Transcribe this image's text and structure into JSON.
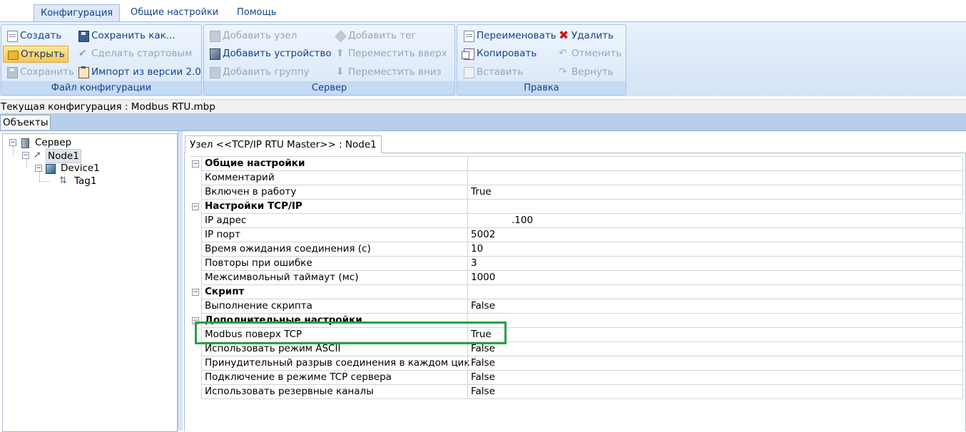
{
  "ribbon_tabs": [
    "Конфигурация",
    "Общие настройки",
    "Помощь"
  ],
  "groups": {
    "file": {
      "label": "Файл конфигурации",
      "create": "Создать",
      "open": "Открыть",
      "save": "Сохранить",
      "save_as": "Сохранить как...",
      "make_start": "Сделать стартовым",
      "import": "Импорт из версии 2.0"
    },
    "server": {
      "label": "Сервер",
      "add_node": "Добавить узел",
      "add_device": "Добавить устройство",
      "add_group": "Добавить группу",
      "add_tag": "Добавить тег",
      "move_up": "Переместить вверх",
      "move_down": "Переместить вниз"
    },
    "edit": {
      "label": "Правка",
      "rename": "Переименовать",
      "copy": "Копировать",
      "paste": "Вставить",
      "delete": "Удалить",
      "undo": "Отменить",
      "redo": "Вернуть"
    }
  },
  "current_config": "Текущая конфигурация : Modbus RTU.mbp",
  "objects_tab": "Объекты",
  "tree": {
    "server": "Сервер",
    "node": "Node1",
    "device": "Device1",
    "tag": "Tag1"
  },
  "doc_tab": "Узел <<TCP/IP RTU Master>> : Node1",
  "properties": [
    {
      "category": true,
      "name": "Общие настройки",
      "value": ""
    },
    {
      "name": "Комментарий",
      "value": ""
    },
    {
      "name": "Включен в работу",
      "value": "True"
    },
    {
      "category": true,
      "name": "Настройки TCP/IP",
      "value": ""
    },
    {
      "name": "IP адрес",
      "value": ".100"
    },
    {
      "name": "IP порт",
      "value": "5002"
    },
    {
      "name": "Время ожидания соединения (с)",
      "value": "10"
    },
    {
      "name": "Повторы при ошибке",
      "value": "3"
    },
    {
      "name": "Межсимвольный таймаут (мс)",
      "value": "1000"
    },
    {
      "category": true,
      "name": "Скрипт",
      "value": ""
    },
    {
      "name": "Выполнение скрипта",
      "value": "False"
    },
    {
      "category": true,
      "name": "Дополнительные настройки",
      "value": ""
    },
    {
      "name": "Modbus поверх TCP",
      "value": "True"
    },
    {
      "name": "Использовать режим ASCII",
      "value": "False"
    },
    {
      "name": "Принудительный разрыв соединения в каждом цикле",
      "value": "False"
    },
    {
      "name": "Подключение в режиме TCP сервера",
      "value": "False"
    },
    {
      "name": "Использовать резервные каналы",
      "value": "False"
    }
  ],
  "colors": {
    "highlight_frame": "#25a244",
    "ribbon_text": "#15428b"
  }
}
